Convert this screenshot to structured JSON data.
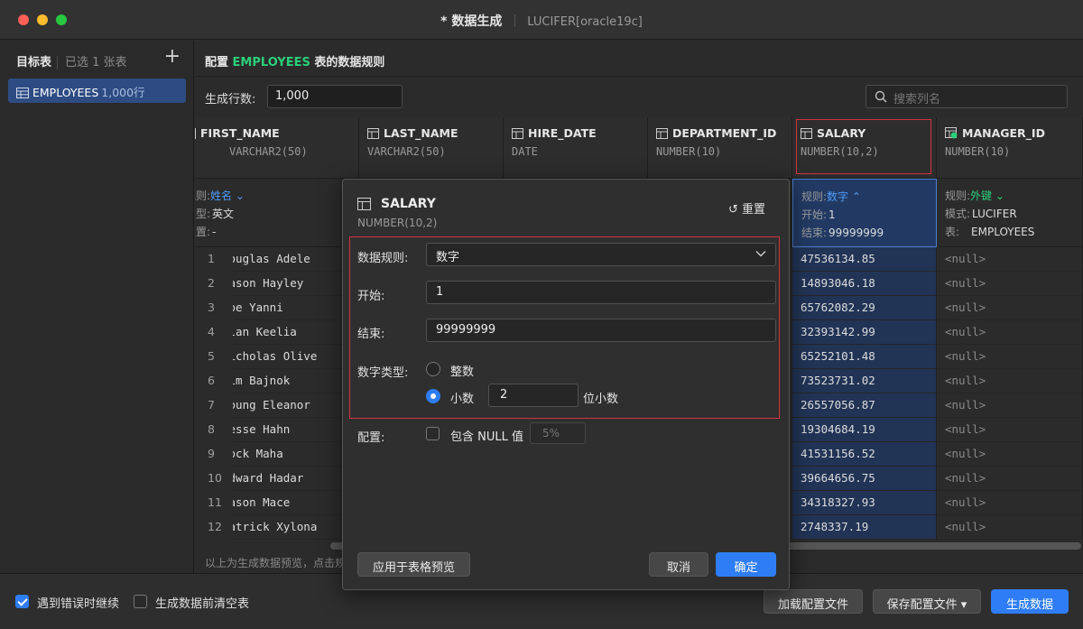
{
  "window": {
    "title": "* 数据生成",
    "connection": "LUCIFER[oracle19c]"
  },
  "sidebar": {
    "heading": "目标表",
    "selected_count": "已选 1 张表",
    "add_label": "+",
    "items": [
      {
        "name": "EMPLOYEES",
        "rows": "1,000行"
      }
    ]
  },
  "main": {
    "heading_prefix": "配置",
    "heading_table": "EMPLOYEES",
    "heading_suffix": "表的数据规则",
    "rows_label": "生成行数:",
    "rows_value": "1,000",
    "search_placeholder": "搜索列名"
  },
  "columns": [
    {
      "name": "FIRST_NAME",
      "type": "VARCHAR2(50)"
    },
    {
      "name": "LAST_NAME",
      "type": "VARCHAR2(50)"
    },
    {
      "name": "HIRE_DATE",
      "type": "DATE"
    },
    {
      "name": "DEPARTMENT_ID",
      "type": "NUMBER(10)"
    },
    {
      "name": "SALARY",
      "type": "NUMBER(10,2)"
    },
    {
      "name": "MANAGER_ID",
      "type": "NUMBER(10)"
    }
  ],
  "rules": {
    "first_name": {
      "l1": "规则:",
      "v1": "姓名",
      "l2": "类型:",
      "v2": "英文",
      "l3": "位置:",
      "v3": "-"
    },
    "salary": {
      "l1": "规则:",
      "v1": "数字",
      "l2": "开始:",
      "v2": "1",
      "l3": "结束:",
      "v3": "99999999"
    },
    "manager_id": {
      "l1": "规则:",
      "v1": "外键",
      "l2": "模式:",
      "v2": "LUCIFER",
      "l3": "表:",
      "v3": "EMPLOYEES"
    }
  },
  "rows": [
    {
      "n": "1",
      "first": "Douglas Adele",
      "salary": "47536134.85",
      "manager": "<null>"
    },
    {
      "n": "2",
      "first": "Jason Hayley",
      "salary": "14893046.18",
      "manager": "<null>"
    },
    {
      "n": "3",
      "first": "Joe Yanni",
      "salary": "65762082.29",
      "manager": "<null>"
    },
    {
      "n": "4",
      "first": "Alan Keelia",
      "salary": "32393142.99",
      "manager": "<null>"
    },
    {
      "n": "5",
      "first": "Nicholas Olive",
      "salary": "65252101.48",
      "manager": "<null>"
    },
    {
      "n": "6",
      "first": "Kim Bajnok",
      "salary": "73523731.02",
      "manager": "<null>"
    },
    {
      "n": "7",
      "first": "Young Eleanor",
      "salary": "26557056.87",
      "manager": "<null>"
    },
    {
      "n": "8",
      "first": "Jesse Hahn",
      "salary": "19304684.19",
      "manager": "<null>"
    },
    {
      "n": "9",
      "first": "Jock Maha",
      "salary": "41531156.52",
      "manager": "<null>"
    },
    {
      "n": "10",
      "first": "Edward Hadar",
      "salary": "39664656.75",
      "manager": "<null>"
    },
    {
      "n": "11",
      "first": "Jason Mace",
      "salary": "34318327.93",
      "manager": "<null>"
    },
    {
      "n": "12",
      "first": "Patrick Xylona",
      "salary": "2748337.19",
      "manager": "<null>"
    }
  ],
  "preview_note": "以上为生成数据预览，点击规",
  "dialog": {
    "title": "SALARY",
    "type": "NUMBER(10,2)",
    "reset_label": "重置",
    "rule_label": "数据规则:",
    "rule_value": "数字",
    "start_label": "开始:",
    "start_value": "1",
    "end_label": "结束:",
    "end_value": "99999999",
    "numtype_label": "数字类型:",
    "integer_label": "整数",
    "decimal_label": "小数",
    "decimal_places": "2",
    "decimal_suffix": "位小数",
    "config_label": "配置:",
    "include_null_label": "包含 NULL 值",
    "null_pct": "5%",
    "apply_label": "应用于表格预览",
    "cancel_label": "取消",
    "ok_label": "确定"
  },
  "footer": {
    "continue_on_error": "遇到错误时继续",
    "clear_before": "生成数据前清空表",
    "load_config": "加载配置文件",
    "save_config": "保存配置文件",
    "generate": "生成数据"
  },
  "colors": {
    "accent_blue": "#2f7df6",
    "table_green": "#2bd07a",
    "highlight_red": "#d0323f"
  }
}
